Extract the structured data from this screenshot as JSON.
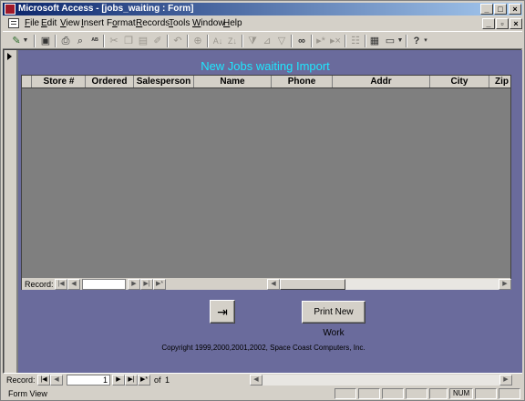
{
  "window": {
    "title": "Microsoft Access - [jobs_waiting : Form]",
    "controls": [
      "_",
      "□",
      "×"
    ]
  },
  "menu": {
    "items": [
      {
        "label": "File",
        "key": "F",
        "rest": "ile"
      },
      {
        "label": "Edit",
        "key": "E",
        "rest": "dit"
      },
      {
        "label": "View",
        "key": "V",
        "rest": "iew"
      },
      {
        "label": "Insert",
        "key": "I",
        "rest": "nsert"
      },
      {
        "label": "Format",
        "key": "o",
        "pre": "F",
        "rest": "rmat"
      },
      {
        "label": "Records",
        "key": "R",
        "rest": "ecords"
      },
      {
        "label": "Tools",
        "key": "T",
        "rest": "ools"
      },
      {
        "label": "Window",
        "key": "W",
        "rest": "indow"
      },
      {
        "label": "Help",
        "key": "H",
        "rest": "elp"
      }
    ],
    "mdi_controls": [
      "_",
      "▫",
      "×"
    ]
  },
  "toolbar": {
    "icons": [
      "design-view-icon",
      "save-icon",
      "print-icon",
      "print-preview-icon",
      "spelling-icon",
      "cut-icon",
      "copy-icon",
      "paste-icon",
      "format-painter-icon",
      "undo-icon",
      "hyperlink-icon",
      "sort-ascending-icon",
      "sort-descending-icon",
      "filter-by-selection-icon",
      "filter-by-form-icon",
      "apply-filter-icon",
      "find-icon",
      "new-record-icon",
      "delete-record-icon",
      "properties-icon",
      "database-window-icon",
      "new-object-icon",
      "help-icon"
    ]
  },
  "form": {
    "heading": "New Jobs waiting Import",
    "columns": [
      "Store #",
      "Ordered",
      "Salesperson",
      "Name",
      "Phone",
      "Addr",
      "City",
      "Zip"
    ],
    "subform_nav": {
      "label": "Record:",
      "value": ""
    },
    "exit_icon": "exit-door-icon",
    "print_button": "Print New Work",
    "copyright": "Copyright 1999,2000,2001,2002, Space Coast Computers, Inc."
  },
  "record_nav": {
    "label": "Record:",
    "current": "1",
    "of_label": "of",
    "total": "1"
  },
  "status": {
    "mode": "Form View",
    "indicator": "NUM"
  },
  "colors": {
    "form_background": "#6a6b9c",
    "heading": "#1ee8ff",
    "title_bar": "#0a246a"
  }
}
